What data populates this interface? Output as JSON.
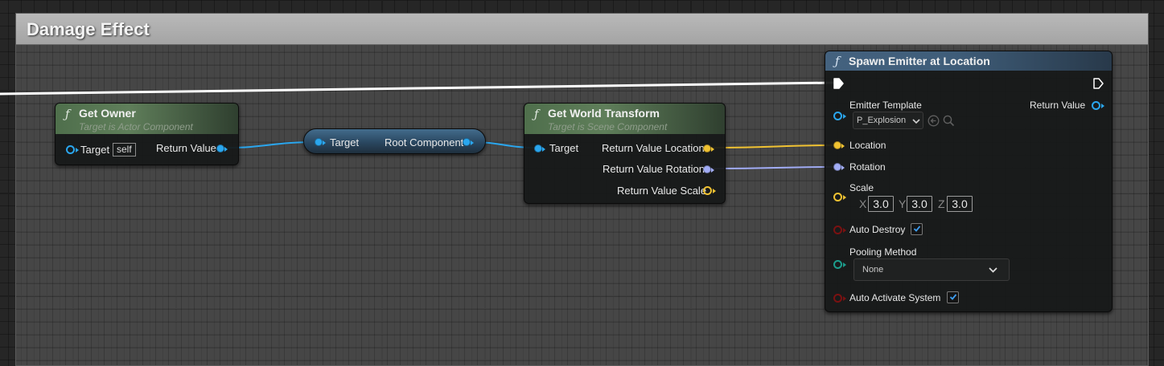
{
  "comment": {
    "title": "Damage Effect"
  },
  "colors": {
    "object_pin": "#2aa6ee",
    "vector_pin": "#f0c232",
    "rotator_pin": "#a2adf6",
    "bool_pin": "#7a1111",
    "enum_pin": "#1c9d8c",
    "exec_wire": "#ffffff"
  },
  "get_owner": {
    "title": "Get Owner",
    "subtitle": "Target is Actor Component",
    "target_label": "Target",
    "target_default": "self",
    "output_label": "Return Value"
  },
  "reroute": {
    "input_label": "Target",
    "output_label": "Root Component"
  },
  "get_world_transform": {
    "title": "Get World Transform",
    "subtitle": "Target is Scene Component",
    "target_label": "Target",
    "out_location": "Return Value Location",
    "out_rotation": "Return Value Rotation",
    "out_scale": "Return Value Scale"
  },
  "spawn_emitter": {
    "title": "Spawn Emitter at Location",
    "emitter_template_label": "Emitter Template",
    "emitter_template_value": "P_Explosion",
    "return_value_label": "Return Value",
    "location_label": "Location",
    "rotation_label": "Rotation",
    "scale_label": "Scale",
    "scale": {
      "x_label": "X",
      "x": "3.0",
      "y_label": "Y",
      "y": "3.0",
      "z_label": "Z",
      "z": "3.0"
    },
    "auto_destroy_label": "Auto Destroy",
    "auto_destroy": true,
    "pooling_method_label": "Pooling Method",
    "pooling_method_value": "None",
    "auto_activate_label": "Auto Activate System",
    "auto_activate": true
  }
}
